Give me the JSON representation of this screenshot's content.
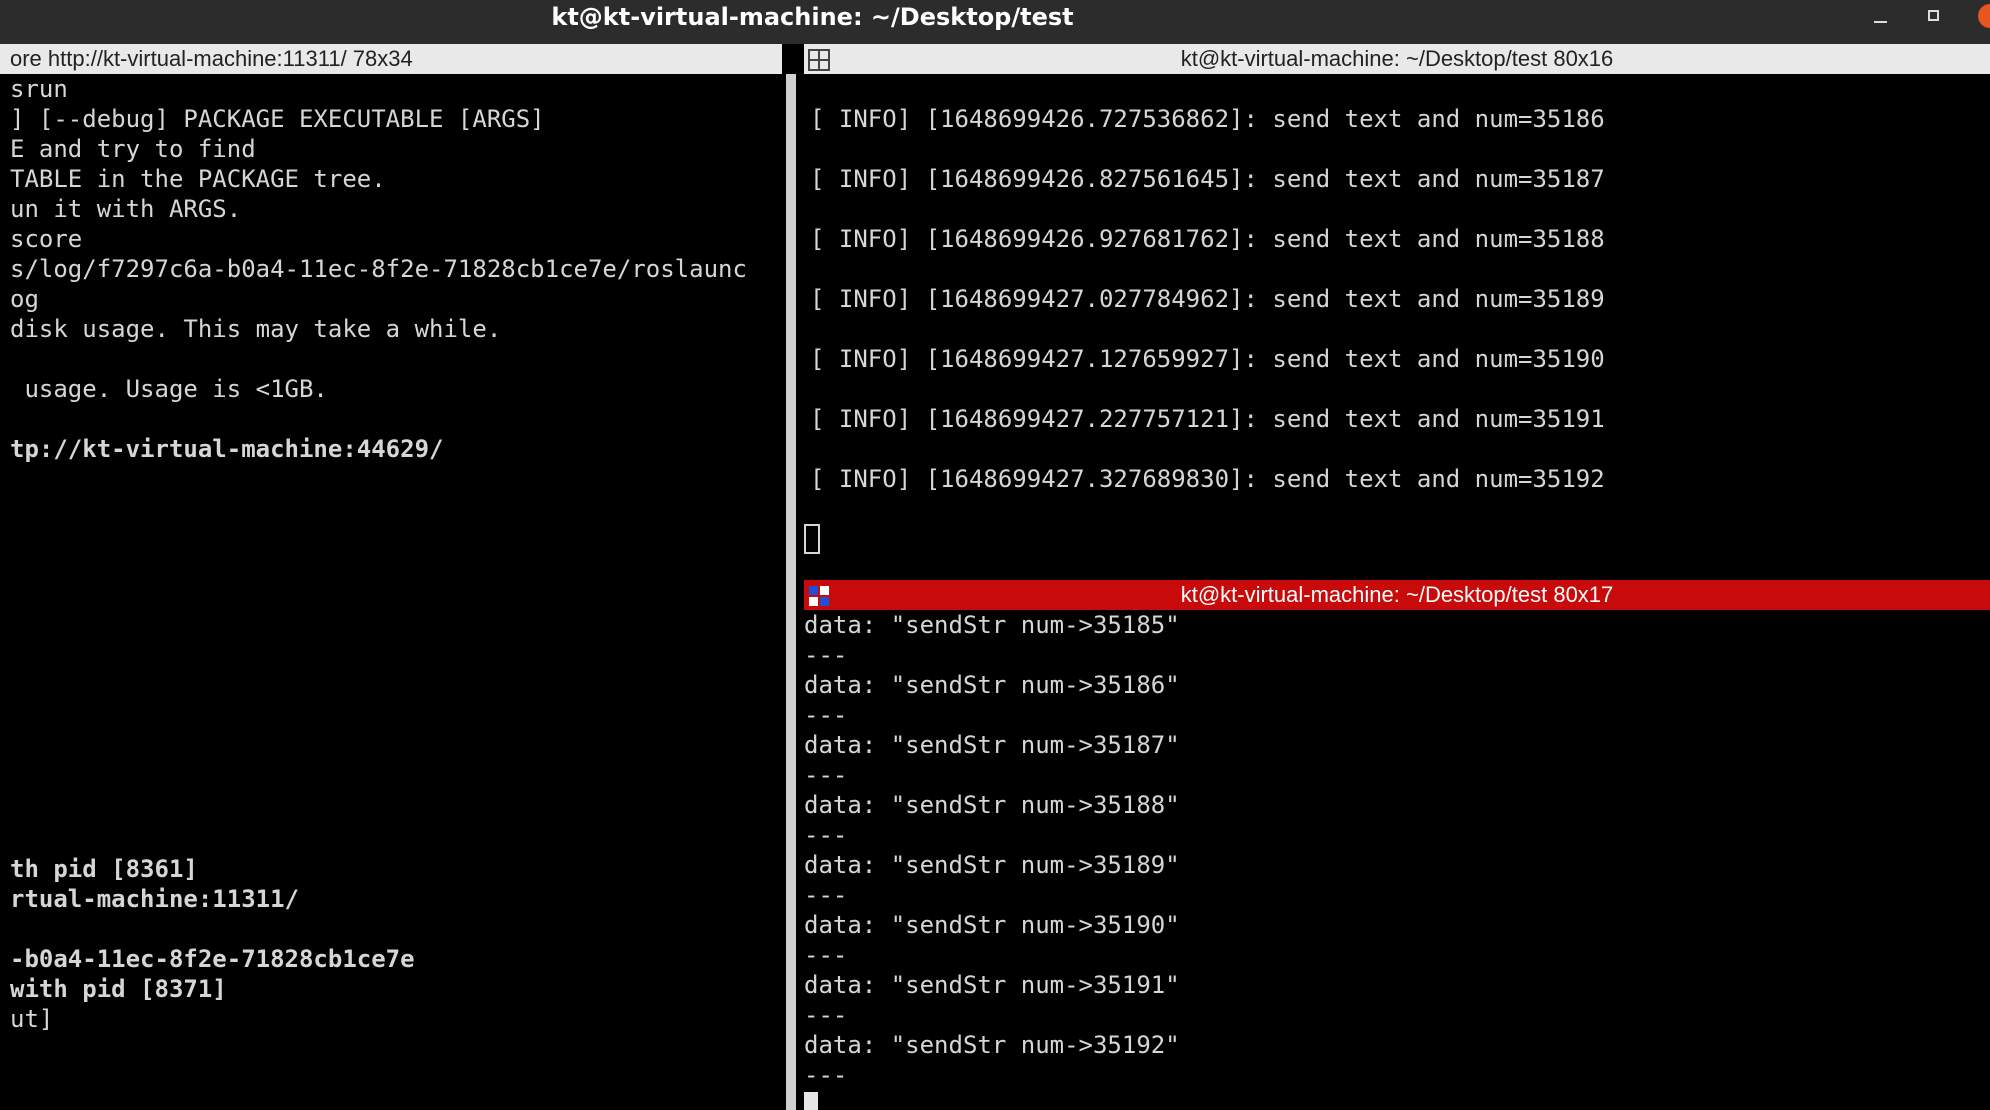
{
  "window": {
    "title": "kt@kt-virtual-machine: ~/Desktop/test"
  },
  "left_pane": {
    "header": "ore http://kt-virtual-machine:11311/ 78x34",
    "lines": [
      {
        "text": "srun",
        "bold": false
      },
      {
        "text": "] [--debug] PACKAGE EXECUTABLE [ARGS]",
        "bold": false
      },
      {
        "text": "E and try to find",
        "bold": false
      },
      {
        "text": "TABLE in the PACKAGE tree.",
        "bold": false
      },
      {
        "text": "un it with ARGS.",
        "bold": false
      },
      {
        "text": "score",
        "bold": false
      },
      {
        "text": "s/log/f7297c6a-b0a4-11ec-8f2e-71828cb1ce7e/roslaunc",
        "bold": false
      },
      {
        "text": "og",
        "bold": false
      },
      {
        "text": "disk usage. This may take a while.",
        "bold": false
      },
      {
        "text": "",
        "bold": false
      },
      {
        "text": " usage. Usage is <1GB.",
        "bold": false
      },
      {
        "text": "",
        "bold": false
      },
      {
        "text": "tp://kt-virtual-machine:44629/",
        "bold": true
      },
      {
        "text": "",
        "bold": false
      },
      {
        "text": "",
        "bold": false
      },
      {
        "text": "",
        "bold": false
      },
      {
        "text": "",
        "bold": false
      },
      {
        "text": "",
        "bold": false
      },
      {
        "text": "",
        "bold": false
      },
      {
        "text": "",
        "bold": false
      },
      {
        "text": "",
        "bold": false
      },
      {
        "text": "",
        "bold": false
      },
      {
        "text": "",
        "bold": false
      },
      {
        "text": "",
        "bold": false
      },
      {
        "text": "",
        "bold": false
      },
      {
        "text": "",
        "bold": false
      },
      {
        "text": "th pid [8361]",
        "bold": true
      },
      {
        "text": "rtual-machine:11311/",
        "bold": true
      },
      {
        "text": "",
        "bold": false
      },
      {
        "text": "-b0a4-11ec-8f2e-71828cb1ce7e",
        "bold": true
      },
      {
        "text": "with pid [8371]",
        "bold": true
      },
      {
        "text": "ut]",
        "bold": false
      }
    ]
  },
  "top_right_pane": {
    "header": "kt@kt-virtual-machine: ~/Desktop/test 80x16",
    "lines": [
      "",
      "[ INFO] [1648699426.727536862]: send text and num=35186",
      "",
      "[ INFO] [1648699426.827561645]: send text and num=35187",
      "",
      "[ INFO] [1648699426.927681762]: send text and num=35188",
      "",
      "[ INFO] [1648699427.027784962]: send text and num=35189",
      "",
      "[ INFO] [1648699427.127659927]: send text and num=35190",
      "",
      "[ INFO] [1648699427.227757121]: send text and num=35191",
      "",
      "[ INFO] [1648699427.327689830]: send text and num=35192"
    ]
  },
  "bottom_right_pane": {
    "header": "kt@kt-virtual-machine: ~/Desktop/test 80x17",
    "lines": [
      "data: \"sendStr num->35185\"",
      "---",
      "data: \"sendStr num->35186\"",
      "---",
      "data: \"sendStr num->35187\"",
      "---",
      "data: \"sendStr num->35188\"",
      "---",
      "data: \"sendStr num->35189\"",
      "---",
      "data: \"sendStr num->35190\"",
      "---",
      "data: \"sendStr num->35191\"",
      "---",
      "data: \"sendStr num->35192\"",
      "---"
    ]
  },
  "icons": {
    "grid": "terminator-grid-icon",
    "minimize": "minimize-icon",
    "maximize": "maximize-icon",
    "close": "close-icon"
  },
  "colors": {
    "titlebar_bg": "#2c2c2c",
    "header_grey": "#e9e9e9",
    "header_active": "#c90a0a",
    "terminal_text": "#d6d6d6",
    "terminal_bg": "#000000"
  }
}
